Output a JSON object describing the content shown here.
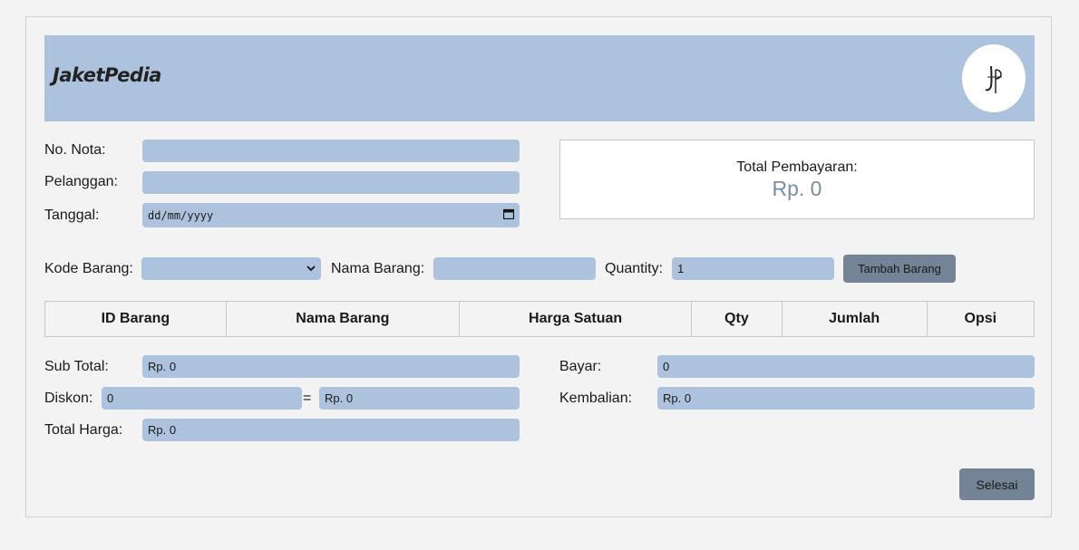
{
  "header": {
    "brand": "JaketPedia",
    "logo_text": "JP"
  },
  "form": {
    "no_nota_label": "No. Nota:",
    "no_nota_value": "",
    "pelanggan_label": "Pelanggan:",
    "pelanggan_value": "",
    "tanggal_label": "Tanggal:",
    "tanggal_placeholder": "dd/mm/yyyy"
  },
  "total_panel": {
    "label": "Total Pembayaran:",
    "value": "Rp. 0"
  },
  "item_entry": {
    "kode_label": "Kode Barang:",
    "kode_selected": "",
    "nama_label": "Nama Barang:",
    "nama_value": "",
    "qty_label": "Quantity:",
    "qty_value": "1",
    "add_button": "Tambah Barang"
  },
  "table": {
    "columns": [
      "ID Barang",
      "Nama Barang",
      "Harga Satuan",
      "Qty",
      "Jumlah",
      "Opsi"
    ],
    "rows": []
  },
  "summary": {
    "subtotal_label": "Sub Total:",
    "subtotal_value": "Rp. 0",
    "diskon_label": "Diskon:",
    "diskon_value": "0",
    "equals": "=",
    "diskon_result": "Rp. 0",
    "total_harga_label": "Total Harga:",
    "total_harga_value": "Rp. 0",
    "bayar_label": "Bayar:",
    "bayar_value": "0",
    "kembalian_label": "Kembalian:",
    "kembalian_value": "Rp. 0"
  },
  "actions": {
    "finish_button": "Selesai"
  }
}
